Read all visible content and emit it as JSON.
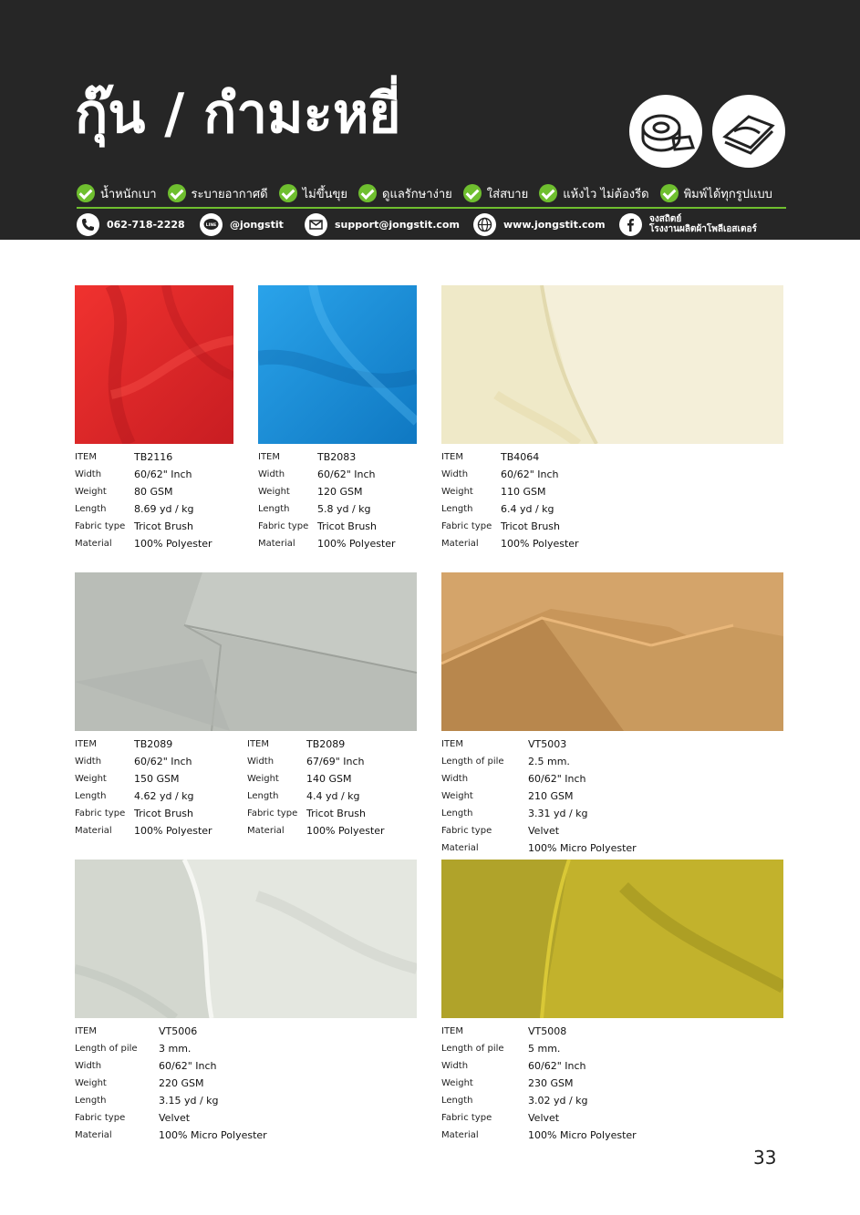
{
  "header": {
    "title": "กุ๊น / กำมะหยี่",
    "features": [
      "น้ำหนักเบา",
      "ระบายอากาศดี",
      "ไม่ขึ้นขุย",
      "ดูแลรักษาง่าย",
      "ใส่สบาย",
      "แห้งไว ไม่ต้องรีด",
      "พิมพ์ได้ทุกรูปแบบ"
    ],
    "contacts": {
      "phone": "062-718-2228",
      "line_badge": "LINE",
      "line": "@jongstit",
      "email": "support@jongstit.com",
      "web": "www.jongstit.com",
      "facebook_name": "จงสถิตย์",
      "facebook_sub": "โรงงานผลิตผ้าโพลีเอสเตอร์"
    }
  },
  "colors": {
    "header_bg": "#262626",
    "accent_green": "#6fbf2f",
    "tb2116": "#e0262a",
    "tb2083": "#1a8fd8",
    "tb4064": "#f4efd6",
    "tb2089": "#b8bcb6",
    "vt5003": "#c99758",
    "vt5006": "#dcdfd8",
    "vt5008": "#b8a525"
  },
  "icons": [
    "check-icon",
    "phone-icon",
    "line-icon",
    "mail-icon",
    "globe-icon",
    "facebook-icon",
    "tape-roll-icon",
    "folded-fabric-icon"
  ],
  "products": {
    "tb2116": {
      "labels": [
        "ITEM",
        "Width",
        "Weight",
        "Length",
        "Fabric type",
        "Material"
      ],
      "values": [
        "TB2116",
        "60/62\" Inch",
        "80 GSM",
        "8.69 yd / kg",
        "Tricot Brush",
        "100% Polyester"
      ]
    },
    "tb2083": {
      "labels": [
        "ITEM",
        "Width",
        "Weight",
        "Length",
        "Fabric type",
        "Material"
      ],
      "values": [
        "TB2083",
        "60/62\" Inch",
        "120 GSM",
        "5.8 yd / kg",
        "Tricot Brush",
        "100% Polyester"
      ]
    },
    "tb4064": {
      "labels": [
        "ITEM",
        "Width",
        "Weight",
        "Length",
        "Fabric type",
        "Material"
      ],
      "values": [
        "TB4064",
        "60/62\" Inch",
        "110 GSM",
        "6.4 yd / kg",
        "Tricot Brush",
        "100% Polyester"
      ]
    },
    "tb2089a": {
      "labels": [
        "ITEM",
        "Width",
        "Weight",
        "Length",
        "Fabric type",
        "Material"
      ],
      "values": [
        "TB2089",
        "60/62\" Inch",
        "150 GSM",
        "4.62 yd / kg",
        "Tricot Brush",
        "100% Polyester"
      ]
    },
    "tb2089b": {
      "labels": [
        "ITEM",
        "Width",
        "Weight",
        "Length",
        "Fabric type",
        "Material"
      ],
      "values": [
        "TB2089",
        "67/69\" Inch",
        "140 GSM",
        "4.4 yd / kg",
        "Tricot Brush",
        "100% Polyester"
      ]
    },
    "vt5003": {
      "labels": [
        "ITEM",
        "Length of pile",
        "Width",
        "Weight",
        "Length",
        "Fabric type",
        "Material"
      ],
      "values": [
        "VT5003",
        "2.5 mm.",
        "60/62\" Inch",
        "210 GSM",
        "3.31 yd / kg",
        "Velvet",
        "100% Micro Polyester"
      ]
    },
    "vt5006": {
      "labels": [
        "ITEM",
        "Length of pile",
        "Width",
        "Weight",
        "Length",
        "Fabric type",
        "Material"
      ],
      "values": [
        "VT5006",
        "3 mm.",
        "60/62\" Inch",
        "220 GSM",
        "3.15 yd / kg",
        "Velvet",
        "100% Micro Polyester"
      ]
    },
    "vt5008": {
      "labels": [
        "ITEM",
        "Length of pile",
        "Width",
        "Weight",
        "Length",
        "Fabric type",
        "Material"
      ],
      "values": [
        "VT5008",
        "5 mm.",
        "60/62\" Inch",
        "230 GSM",
        "3.02 yd / kg",
        "Velvet",
        "100% Micro Polyester"
      ]
    }
  },
  "page_number": "33"
}
